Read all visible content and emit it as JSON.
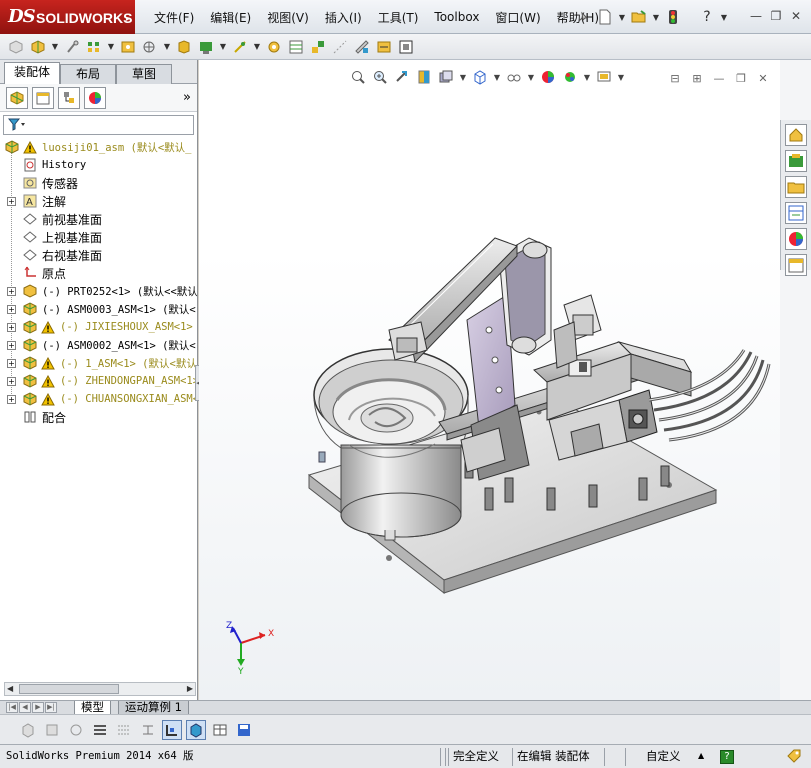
{
  "app": {
    "logo_ds": "DS",
    "logo_name": "SOLIDWORKS"
  },
  "menu": [
    "文件(F)",
    "编辑(E)",
    "视图(V)",
    "插入(I)",
    "工具(T)",
    "Toolbox",
    "窗口(W)",
    "帮助(H)"
  ],
  "left_panel": {
    "tabs": [
      "装配体",
      "布局",
      "草图"
    ],
    "active_tab": 0,
    "more": "»"
  },
  "tree": [
    {
      "label": "luosiji01_asm  (默认<默认_",
      "icon": "assembly-icon",
      "warn": true,
      "level": 0,
      "expand": "",
      "style": "warn"
    },
    {
      "label": "History",
      "icon": "history-icon",
      "level": 1,
      "expand": "",
      "style": "mono"
    },
    {
      "label": "传感器",
      "icon": "sensor-icon",
      "level": 1,
      "expand": "",
      "style": "zh"
    },
    {
      "label": "注解",
      "icon": "annotation-icon",
      "level": 1,
      "expand": "+",
      "style": "zh"
    },
    {
      "label": "前视基准面",
      "icon": "plane-icon",
      "level": 1,
      "expand": "",
      "style": "zh"
    },
    {
      "label": "上视基准面",
      "icon": "plane-icon",
      "level": 1,
      "expand": "",
      "style": "zh"
    },
    {
      "label": "右视基准面",
      "icon": "plane-icon",
      "level": 1,
      "expand": "",
      "style": "zh"
    },
    {
      "label": "原点",
      "icon": "origin-icon",
      "level": 1,
      "expand": "",
      "style": "zh"
    },
    {
      "label": "(-) PRT0252<1> (默认<<默认",
      "icon": "part-icon",
      "level": 1,
      "expand": "+",
      "style": "mono"
    },
    {
      "label": "(-) ASM0003_ASM<1> (默认<",
      "icon": "assembly-icon",
      "level": 1,
      "expand": "+",
      "style": "mono"
    },
    {
      "label": "(-) JIXIESHOUX_ASM<1>",
      "icon": "assembly-icon",
      "warn": true,
      "level": 1,
      "expand": "+",
      "style": "warn"
    },
    {
      "label": "(-) ASM0002_ASM<1> (默认<",
      "icon": "assembly-icon",
      "level": 1,
      "expand": "+",
      "style": "mono"
    },
    {
      "label": "(-) 1_ASM<1> (默认<默认",
      "icon": "assembly-icon",
      "warn": true,
      "level": 1,
      "expand": "+",
      "style": "warn"
    },
    {
      "label": "(-) ZHENDONGPAN_ASM<1>",
      "icon": "assembly-icon",
      "warn": true,
      "level": 1,
      "expand": "+",
      "style": "warn"
    },
    {
      "label": "(-) CHUANSONGXIAN_ASM<1>",
      "icon": "assembly-icon",
      "warn": true,
      "level": 1,
      "expand": "+",
      "style": "warn"
    },
    {
      "label": "配合",
      "icon": "mates-icon",
      "level": 1,
      "expand": "",
      "style": "zh"
    }
  ],
  "triad": {
    "x": "X",
    "y": "Y",
    "z": "Z"
  },
  "bottom_tabs": [
    "模型",
    "运动算例 1"
  ],
  "active_bottom_tab": 0,
  "status": {
    "version": "SolidWorks Premium 2014 x64 版",
    "defined": "完全定义",
    "editing": "在编辑 装配体",
    "units": "自定义",
    "arrow": "▲",
    "help": "?"
  },
  "colors": {
    "logo_red": "#c7241e",
    "warning_yellow": "#f2c200",
    "part_yellow": "#e8b82a",
    "assembly_green": "#3a9a3a"
  }
}
